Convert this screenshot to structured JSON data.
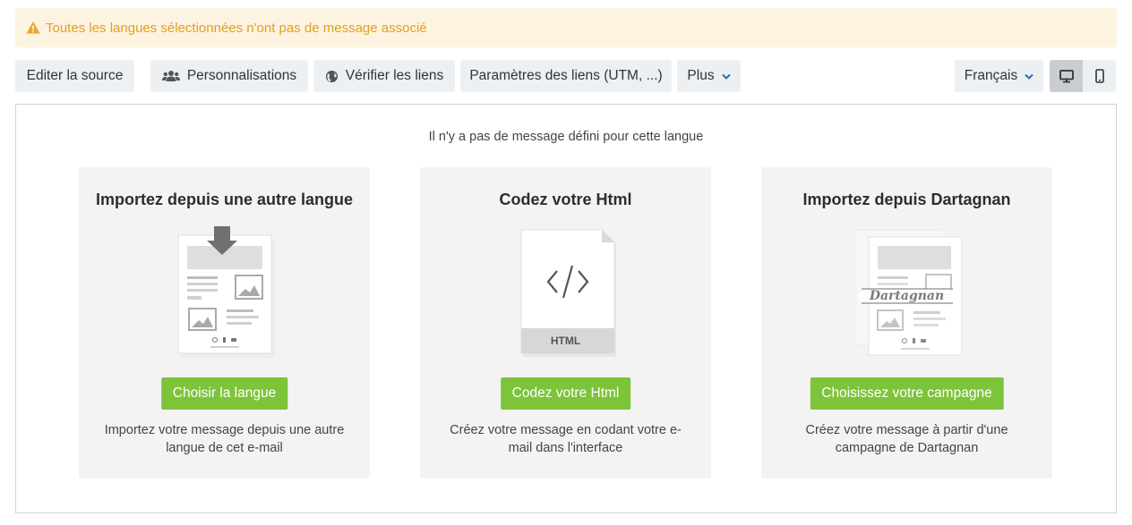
{
  "alert": {
    "icon": "warning-icon",
    "text": "Toutes les langues sélectionnées n'ont pas de message associé",
    "color": "#e0a020",
    "background": "#fdf3e1"
  },
  "toolbar": {
    "edit_source": "Editer la source",
    "personalizations": "Personnalisations",
    "check_links": "Vérifier les liens",
    "link_params": "Paramètres des liens (UTM, ...)",
    "more": "Plus",
    "language": "Français",
    "device_desktop": "desktop-icon",
    "device_mobile": "mobile-icon"
  },
  "main": {
    "empty_message": "Il n'y a pas de message défini pour cette langue",
    "cards": [
      {
        "title": "Importez depuis une autre langue",
        "button": "Choisir la langue",
        "description": "Importez votre message depuis une autre langue de cet e-mail"
      },
      {
        "title": "Codez votre Html",
        "button": "Codez votre Html",
        "description": "Créez votre message en codant votre e-mail dans l'interface",
        "illustration_label": "HTML"
      },
      {
        "title": "Importez depuis Dartagnan",
        "button": "Choisissez votre campagne",
        "description": "Créez votre message à partir d'une campagne de Dartagnan",
        "illustration_label": "Dartagnan"
      }
    ]
  },
  "colors": {
    "accent_green": "#7dc43a",
    "button_bg": "#edf0f3",
    "card_bg": "#f3f3f3"
  }
}
